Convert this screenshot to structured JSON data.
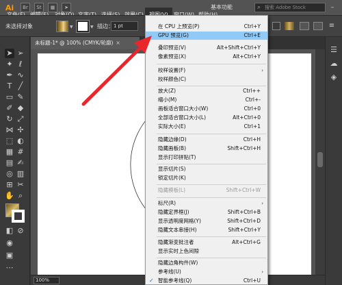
{
  "app": {
    "logo": "Ai"
  },
  "menubar": {
    "items": [
      "文件(F)",
      "编辑(E)",
      "对象(O)",
      "文字(T)",
      "选择(S)",
      "效果(C)",
      "视图(V)",
      "窗口(W)",
      "帮助(H)"
    ],
    "workspace": "基本功能",
    "search_placeholder": "搜索 Adobe Stock"
  },
  "controlbar": {
    "no_selection": "未选择对象",
    "stroke_label": "描边：",
    "stroke_value": "1 pt"
  },
  "document": {
    "tab_title": "未标题-1* @ 100% (CMYK/轮廓)",
    "tab_close": "×",
    "zoom": "100%"
  },
  "view_menu": {
    "items": [
      {
        "label": "在 CPU 上预览(P)",
        "shortcut": "Ctrl+Y"
      },
      {
        "label": "GPU 预览(G)",
        "shortcut": "Ctrl+E",
        "highlighted": true
      },
      {
        "label": "叠印预览(V)",
        "shortcut": "Alt+Shift+Ctrl+Y"
      },
      {
        "label": "像素预览(X)",
        "shortcut": "Alt+Ctrl+Y"
      },
      {
        "label": "校样设置(F)",
        "submenu": true
      },
      {
        "label": "校样颜色(C)"
      },
      {
        "label": "放大(Z)",
        "shortcut": "Ctrl++"
      },
      {
        "label": "缩小(M)",
        "shortcut": "Ctrl+-"
      },
      {
        "label": "画板适合窗口大小(W)",
        "shortcut": "Ctrl+0"
      },
      {
        "label": "全部适合窗口大小(L)",
        "shortcut": "Alt+Ctrl+0"
      },
      {
        "label": "实际大小(E)",
        "shortcut": "Ctrl+1"
      },
      {
        "label": "隐藏边缘(D)",
        "shortcut": "Ctrl+H"
      },
      {
        "label": "隐藏画板(B)",
        "shortcut": "Shift+Ctrl+H"
      },
      {
        "label": "显示打印拼贴(T)"
      },
      {
        "label": "显示切片(S)"
      },
      {
        "label": "锁定切片(K)"
      },
      {
        "label": "隐藏模板(L)",
        "shortcut": "Shift+Ctrl+W",
        "disabled": true
      },
      {
        "label": "标尺(R)",
        "submenu": true
      },
      {
        "label": "隐藏定界框(J)",
        "shortcut": "Shift+Ctrl+B"
      },
      {
        "label": "显示透明度网格(Y)",
        "shortcut": "Shift+Ctrl+D"
      },
      {
        "label": "隐藏文本串接(H)",
        "shortcut": "Shift+Ctrl+Y"
      },
      {
        "label": "隐藏渐变批注者",
        "shortcut": "Alt+Ctrl+G"
      },
      {
        "label": "显示实时上色间隙"
      },
      {
        "label": "隐藏边角构件(W)"
      },
      {
        "label": "参考线(U)",
        "submenu": true
      },
      {
        "label": "智能参考线(Q)",
        "shortcut": "Ctrl+U",
        "checked": true
      }
    ],
    "submenu_arrow": "›",
    "check_mark": "✓"
  },
  "colors": {
    "accent_highlight": "#91c9f7",
    "annotation_arrow": "#e8262c",
    "app_logo": "#ff9a00"
  },
  "icons": {
    "tools": [
      "selection-tool-icon",
      "direct-selection-tool-icon",
      "magic-wand-icon",
      "lasso-icon",
      "pen-tool-icon",
      "curvature-icon",
      "type-tool-icon",
      "line-tool-icon",
      "rectangle-tool-icon",
      "paintbrush-icon",
      "shaper-icon",
      "eraser-icon",
      "rotate-icon",
      "scale-icon",
      "width-icon",
      "puppet-warp-icon",
      "free-transform-icon",
      "shape-builder-icon",
      "perspective-grid-icon",
      "mesh-icon",
      "gradient-icon",
      "eyedropper-icon",
      "blend-icon",
      "symbol-sprayer-icon",
      "column-graph-icon",
      "artboard-icon",
      "slice-icon",
      "hand-icon",
      "zoom-icon"
    ]
  }
}
